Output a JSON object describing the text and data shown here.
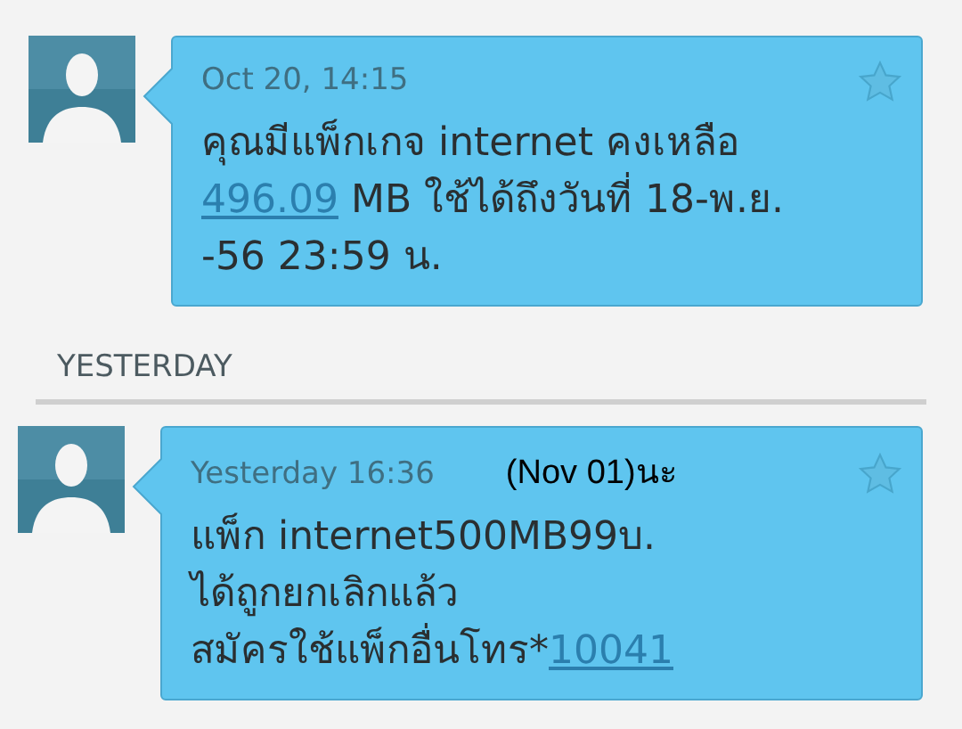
{
  "messages": [
    {
      "time": "Oct 20, 14:15",
      "starred": false,
      "lines": [
        [
          {
            "kind": "text",
            "text": "คุณมีแพ็กเกจ internet คงเหลือ"
          }
        ],
        [
          {
            "kind": "link",
            "text": "496.09"
          },
          {
            "kind": "text",
            "text": " MB ใช้ได้ถึงวันที่ 18-พ.ย."
          }
        ],
        [
          {
            "kind": "text",
            "text": "-56 23:59 น."
          }
        ]
      ]
    },
    {
      "section": "YESTERDAY",
      "time": "Yesterday 16:36",
      "annotation": "(Nov 01)นะ",
      "starred": false,
      "lines": [
        [
          {
            "kind": "text",
            "text": "แพ็ก internet500MB99บ."
          }
        ],
        [
          {
            "kind": "text",
            "text": "ได้ถูกยกเลิกแล้ว"
          }
        ],
        [
          {
            "kind": "text",
            "text": "สมัครใช้แพ็กอื่นโทร*"
          },
          {
            "kind": "link",
            "text": "10041"
          }
        ]
      ]
    }
  ]
}
